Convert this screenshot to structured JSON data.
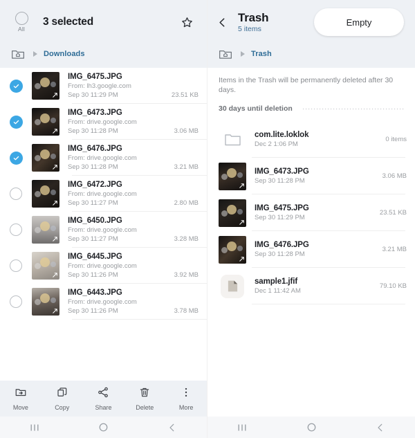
{
  "left": {
    "header": {
      "all_label": "All",
      "selection_title": "3 selected",
      "star_icon": "star-outline-icon",
      "all_checkbox_icon": "circle-unchecked-icon"
    },
    "breadcrumb": {
      "home_icon": "home-folder-icon",
      "label": "Downloads"
    },
    "files": [
      {
        "name": "IMG_6475.JPG",
        "source": "From: lh3.google.com",
        "date": "Sep 30 11:29 PM",
        "size": "23.51 KB",
        "selected": true,
        "thumb": "t-dark"
      },
      {
        "name": "IMG_6473.JPG",
        "source": "From: drive.google.com",
        "date": "Sep 30 11:28 PM",
        "size": "3.06 MB",
        "selected": true,
        "thumb": "t-dark2"
      },
      {
        "name": "IMG_6476.JPG",
        "source": "From: drive.google.com",
        "date": "Sep 30 11:28 PM",
        "size": "3.21 MB",
        "selected": true,
        "thumb": "t-dark3"
      },
      {
        "name": "IMG_6472.JPG",
        "source": "From: drive.google.com",
        "date": "Sep 30 11:27 PM",
        "size": "2.80 MB",
        "selected": false,
        "thumb": "t-dark"
      },
      {
        "name": "IMG_6450.JPG",
        "source": "From: drive.google.com",
        "date": "Sep 30 11:27 PM",
        "size": "3.28 MB",
        "selected": false,
        "thumb": "t-room"
      },
      {
        "name": "IMG_6445.JPG",
        "source": "From: drive.google.com",
        "date": "Sep 30 11:26 PM",
        "size": "3.92 MB",
        "selected": false,
        "thumb": "t-light"
      },
      {
        "name": "IMG_6443.JPG",
        "source": "From: drive.google.com",
        "date": "Sep 30 11:26 PM",
        "size": "3.78 MB",
        "selected": false,
        "thumb": "t-person"
      }
    ],
    "toolbar": [
      {
        "label": "Move",
        "icon": "move-to-folder-icon"
      },
      {
        "label": "Copy",
        "icon": "copy-icon"
      },
      {
        "label": "Share",
        "icon": "share-icon"
      },
      {
        "label": "Delete",
        "icon": "trash-icon"
      },
      {
        "label": "More",
        "icon": "more-vertical-icon"
      }
    ]
  },
  "right": {
    "header": {
      "back_icon": "chevron-left-icon",
      "title": "Trash",
      "subtitle": "5 items",
      "empty_button": "Empty"
    },
    "breadcrumb": {
      "home_icon": "home-folder-icon",
      "label": "Trash"
    },
    "notice": "Items in the Trash will be permanently deleted after 30 days.",
    "countdown_label": "30 days until deletion",
    "items": [
      {
        "name": "com.lite.loklok",
        "date": "Dec 2 1:06 PM",
        "size": "0 items",
        "kind": "folder",
        "thumb": ""
      },
      {
        "name": "IMG_6473.JPG",
        "date": "Sep 30 11:28 PM",
        "size": "3.06 MB",
        "kind": "image",
        "thumb": "t-dark2"
      },
      {
        "name": "IMG_6475.JPG",
        "date": "Sep 30 11:29 PM",
        "size": "23.51 KB",
        "kind": "image",
        "thumb": "t-dark"
      },
      {
        "name": "IMG_6476.JPG",
        "date": "Sep 30 11:28 PM",
        "size": "3.21 MB",
        "kind": "image",
        "thumb": "t-dark3"
      },
      {
        "name": "sample1.jfif",
        "date": "Dec 1 11:42 AM",
        "size": "79.10 KB",
        "kind": "file",
        "thumb": ""
      }
    ]
  },
  "navbar": {
    "recents_icon": "recents-icon",
    "home_icon": "home-circle-icon",
    "back_icon": "back-chevron-icon"
  },
  "colors": {
    "header_bg": "#eef1f5",
    "accent_blue": "#3ca7e4",
    "link_blue": "#2e6c96"
  }
}
